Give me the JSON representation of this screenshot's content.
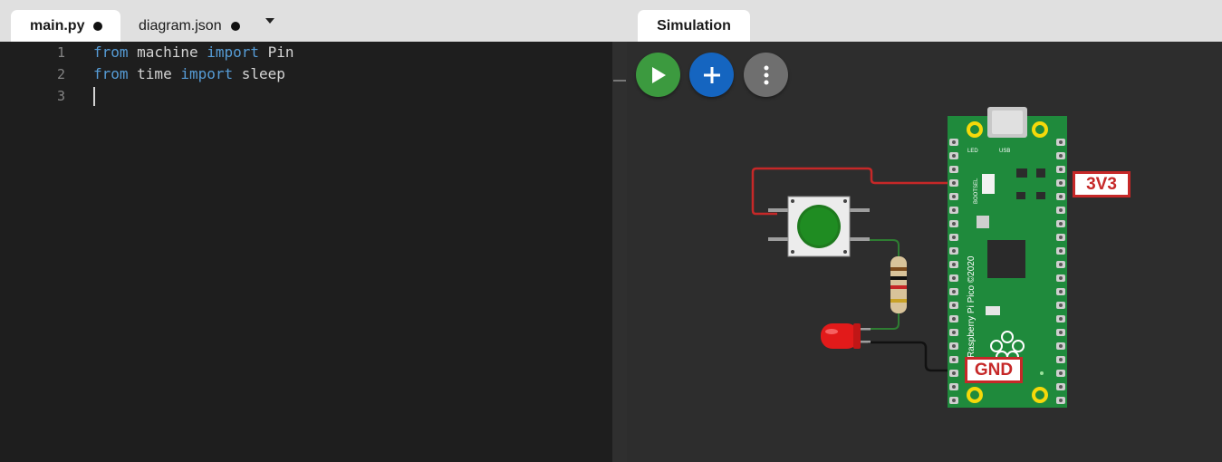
{
  "editor": {
    "tabs": [
      {
        "label": "main.py",
        "unsaved": true
      },
      {
        "label": "diagram.json",
        "unsaved": true
      }
    ],
    "lines": [
      {
        "number": "1",
        "kw1": "from",
        "mod": " machine ",
        "kw2": "import",
        "name": " Pin"
      },
      {
        "number": "2",
        "kw1": "from",
        "mod": " time ",
        "kw2": "import",
        "name": " sleep"
      },
      {
        "number": "3"
      }
    ]
  },
  "simulation": {
    "tab_label": "Simulation",
    "buttons": {
      "play": "play-icon",
      "add": "plus-icon",
      "more": "more-vertical-icon"
    },
    "pin_labels": {
      "power": "3V3",
      "ground": "GND"
    },
    "board_silkscreen": [
      "LED",
      "USB",
      "BOOTSEL",
      "Raspberry Pi Pico ©2020"
    ],
    "colors": {
      "board": "#1f8a3c",
      "button_cap": "#1e7a1e",
      "led": "#e21a1a",
      "wire_power": "#c62828",
      "wire_ground": "#111111",
      "wire_signal": "#2e7d32",
      "label_accent": "#c62828"
    }
  }
}
